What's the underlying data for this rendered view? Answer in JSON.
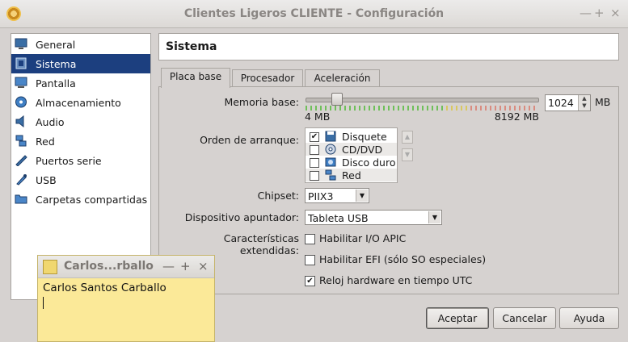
{
  "window": {
    "title": "Clientes Ligeros CLIENTE - Configuración",
    "minimize": "—",
    "maximize": "+",
    "close": "×"
  },
  "sidebar": {
    "items": [
      {
        "label": "General",
        "icon": "monitor-icon"
      },
      {
        "label": "Sistema",
        "icon": "chip-icon",
        "selected": true
      },
      {
        "label": "Pantalla",
        "icon": "display-icon"
      },
      {
        "label": "Almacenamiento",
        "icon": "storage-icon"
      },
      {
        "label": "Audio",
        "icon": "audio-icon"
      },
      {
        "label": "Red",
        "icon": "network-icon"
      },
      {
        "label": "Puertos serie",
        "icon": "serial-port-icon"
      },
      {
        "label": "USB",
        "icon": "usb-icon"
      },
      {
        "label": "Carpetas compartidas",
        "icon": "folder-icon"
      }
    ]
  },
  "section_title": "Sistema",
  "tabs": [
    {
      "label": "Placa base",
      "active": true
    },
    {
      "label": "Procesador"
    },
    {
      "label": "Aceleración"
    }
  ],
  "memory": {
    "label": "Memoria base:",
    "value": "1024",
    "unit": "MB",
    "min_label": "4 MB",
    "max_label": "8192 MB",
    "level": 0.125
  },
  "boot": {
    "label": "Orden de arranque:",
    "items": [
      {
        "label": "Disquete",
        "checked": true,
        "icon": "floppy-icon"
      },
      {
        "label": "CD/DVD",
        "checked": false,
        "icon": "cd-icon"
      },
      {
        "label": "Disco duro",
        "checked": false,
        "icon": "hdd-icon"
      },
      {
        "label": "Red",
        "checked": false,
        "icon": "network-icon"
      }
    ],
    "move_up": "▲",
    "move_down": "▼"
  },
  "chipset": {
    "label": "Chipset:",
    "value": "PIIX3"
  },
  "pointer": {
    "label": "Dispositivo apuntador:",
    "value": "Tableta USB"
  },
  "extended": {
    "label": "Características extendidas:",
    "options": [
      {
        "label": "Habilitar I/O APIC",
        "checked": false
      },
      {
        "label": "Habilitar EFI (sólo SO especiales)",
        "checked": false
      },
      {
        "label": "Reloj hardware en tiempo UTC",
        "checked": true
      }
    ]
  },
  "buttons": {
    "accept": "Aceptar",
    "cancel": "Cancelar",
    "help": "Ayuda"
  },
  "note": {
    "title": "Carlos...rballo",
    "text": "Carlos Santos Carballo",
    "minimize": "—",
    "maximize": "+",
    "close": "×"
  },
  "colors": {
    "selection": "#1c3f7f",
    "window_bg": "#d6d2d0",
    "note_bg": "#fbe998",
    "tick_green": "#6fbf5a",
    "tick_yellow": "#d9c860",
    "tick_red": "#d98c80"
  }
}
